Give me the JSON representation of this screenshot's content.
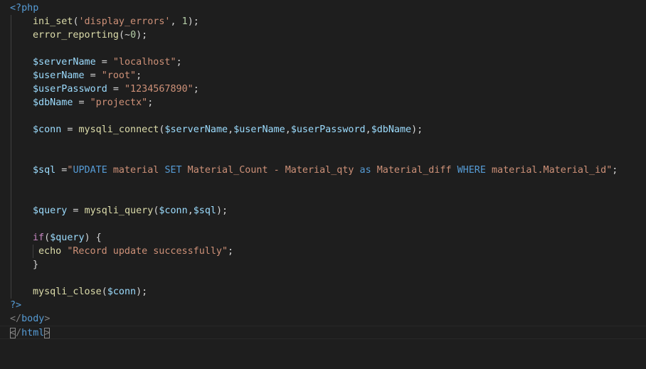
{
  "colors": {
    "background": "#1e1e1e",
    "default": "#d4d4d4",
    "tag": "#569cd6",
    "function": "#dcdcaa",
    "string": "#ce9178",
    "variable": "#9cdcfe",
    "number": "#b5cea8",
    "control": "#c586c0",
    "punctuation": "#d4d4d4",
    "html_tag": "#808080"
  },
  "editor": {
    "lines": [
      {
        "indent": 0,
        "tokens": [
          {
            "t": "<?php",
            "k": "tag"
          }
        ]
      },
      {
        "indent": 1,
        "tokens": [
          {
            "t": "ini_set",
            "k": "function"
          },
          {
            "t": "(",
            "k": "punctuation"
          },
          {
            "t": "'display_errors'",
            "k": "string"
          },
          {
            "t": ", ",
            "k": "punctuation"
          },
          {
            "t": "1",
            "k": "number"
          },
          {
            "t": ");",
            "k": "punctuation"
          }
        ]
      },
      {
        "indent": 1,
        "tokens": [
          {
            "t": "error_reporting",
            "k": "function"
          },
          {
            "t": "(~",
            "k": "punctuation"
          },
          {
            "t": "0",
            "k": "number"
          },
          {
            "t": ");",
            "k": "punctuation"
          }
        ]
      },
      {
        "indent": 1,
        "tokens": []
      },
      {
        "indent": 1,
        "tokens": [
          {
            "t": "$serverName",
            "k": "variable"
          },
          {
            "t": " = ",
            "k": "punctuation"
          },
          {
            "t": "\"localhost\"",
            "k": "string"
          },
          {
            "t": ";",
            "k": "punctuation"
          }
        ]
      },
      {
        "indent": 1,
        "tokens": [
          {
            "t": "$userName",
            "k": "variable"
          },
          {
            "t": " = ",
            "k": "punctuation"
          },
          {
            "t": "\"root\"",
            "k": "string"
          },
          {
            "t": ";",
            "k": "punctuation"
          }
        ]
      },
      {
        "indent": 1,
        "tokens": [
          {
            "t": "$userPassword",
            "k": "variable"
          },
          {
            "t": " = ",
            "k": "punctuation"
          },
          {
            "t": "\"1234567890\"",
            "k": "string"
          },
          {
            "t": ";",
            "k": "punctuation"
          }
        ]
      },
      {
        "indent": 1,
        "tokens": [
          {
            "t": "$dbName",
            "k": "variable"
          },
          {
            "t": " = ",
            "k": "punctuation"
          },
          {
            "t": "\"projectx\"",
            "k": "string"
          },
          {
            "t": ";",
            "k": "punctuation"
          }
        ]
      },
      {
        "indent": 1,
        "tokens": []
      },
      {
        "indent": 1,
        "tokens": [
          {
            "t": "$conn",
            "k": "variable"
          },
          {
            "t": " = ",
            "k": "punctuation"
          },
          {
            "t": "mysqli_connect",
            "k": "function"
          },
          {
            "t": "(",
            "k": "punctuation"
          },
          {
            "t": "$serverName",
            "k": "variable"
          },
          {
            "t": ",",
            "k": "punctuation"
          },
          {
            "t": "$userName",
            "k": "variable"
          },
          {
            "t": ",",
            "k": "punctuation"
          },
          {
            "t": "$userPassword",
            "k": "variable"
          },
          {
            "t": ",",
            "k": "punctuation"
          },
          {
            "t": "$dbName",
            "k": "variable"
          },
          {
            "t": ");",
            "k": "punctuation"
          }
        ]
      },
      {
        "indent": 1,
        "tokens": []
      },
      {
        "indent": 1,
        "tokens": []
      },
      {
        "indent": 1,
        "tokens": [
          {
            "t": "$sql",
            "k": "variable"
          },
          {
            "t": " =",
            "k": "punctuation"
          },
          {
            "t": "\"",
            "k": "string"
          },
          {
            "t": "UPDATE",
            "k": "tag"
          },
          {
            "t": " material ",
            "k": "string"
          },
          {
            "t": "SET",
            "k": "tag"
          },
          {
            "t": " Material_Count - Material_qty ",
            "k": "string"
          },
          {
            "t": "as",
            "k": "tag"
          },
          {
            "t": " Material_diff ",
            "k": "string"
          },
          {
            "t": "WHERE",
            "k": "tag"
          },
          {
            "t": " material.Material_id\"",
            "k": "string"
          },
          {
            "t": ";",
            "k": "punctuation"
          }
        ]
      },
      {
        "indent": 1,
        "tokens": []
      },
      {
        "indent": 1,
        "tokens": []
      },
      {
        "indent": 1,
        "tokens": [
          {
            "t": "$query",
            "k": "variable"
          },
          {
            "t": " = ",
            "k": "punctuation"
          },
          {
            "t": "mysqli_query",
            "k": "function"
          },
          {
            "t": "(",
            "k": "punctuation"
          },
          {
            "t": "$conn",
            "k": "variable"
          },
          {
            "t": ",",
            "k": "punctuation"
          },
          {
            "t": "$sql",
            "k": "variable"
          },
          {
            "t": ");",
            "k": "punctuation"
          }
        ]
      },
      {
        "indent": 1,
        "tokens": []
      },
      {
        "indent": 1,
        "tokens": [
          {
            "t": "if",
            "k": "control"
          },
          {
            "t": "(",
            "k": "punctuation"
          },
          {
            "t": "$query",
            "k": "variable"
          },
          {
            "t": ") {",
            "k": "punctuation"
          }
        ]
      },
      {
        "indent": 2,
        "tokens": [
          {
            "t": "echo",
            "k": "function"
          },
          {
            "t": " ",
            "k": "punctuation"
          },
          {
            "t": "\"Record update successfully\"",
            "k": "string"
          },
          {
            "t": ";",
            "k": "punctuation"
          }
        ]
      },
      {
        "indent": 1,
        "tokens": [
          {
            "t": "}",
            "k": "punctuation"
          }
        ]
      },
      {
        "indent": 1,
        "tokens": []
      },
      {
        "indent": 1,
        "tokens": [
          {
            "t": "mysqli_close",
            "k": "function"
          },
          {
            "t": "(",
            "k": "punctuation"
          },
          {
            "t": "$conn",
            "k": "variable"
          },
          {
            "t": ");",
            "k": "punctuation"
          }
        ]
      },
      {
        "indent": 0,
        "tokens": [
          {
            "t": "?>",
            "k": "tag"
          }
        ]
      },
      {
        "indent": 0,
        "tokens": [
          {
            "t": "</",
            "k": "html_tag"
          },
          {
            "t": "body",
            "k": "tag"
          },
          {
            "t": ">",
            "k": "html_tag"
          }
        ]
      },
      {
        "indent": 0,
        "active": true,
        "tokens": [
          {
            "t": "<",
            "k": "html_tag",
            "bracket": true,
            "cursor_before": true
          },
          {
            "t": "/",
            "k": "html_tag"
          },
          {
            "t": "html",
            "k": "tag"
          },
          {
            "t": ">",
            "k": "html_tag",
            "bracket": true
          }
        ]
      }
    ]
  }
}
